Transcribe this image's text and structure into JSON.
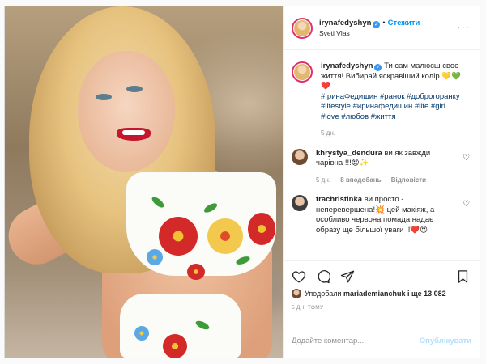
{
  "header": {
    "username": "irynafedyshyn",
    "follow_label": "Стежити",
    "location": "Sveti Vlas",
    "more_label": "···"
  },
  "caption": {
    "username": "irynafedyshyn",
    "text": "Ти сам малюєш своє життя! Вибирай яскравіший колір 💛💚❤️",
    "hashtags": "#ІринаФедишин #ранок #доброгоранку #lifestyle #иринафедишин #life #girl #love #любов #життя",
    "time": "5 дн."
  },
  "comments": [
    {
      "username": "khrystya_dendura",
      "text": "ви як завжди чарівна !!!😍✨",
      "time": "5 дн.",
      "likes": "8 вподобань",
      "reply": "Відповісти"
    },
    {
      "username": "trachristinka",
      "text": "ви просто - неперевершена!💥 цей макіяж, а особливо червона помада надає образу ще більшої уваги !!❤️😍",
      "time": "",
      "likes": "",
      "reply": ""
    }
  ],
  "likes": {
    "prefix": "Уподобали",
    "user": "mariademianchuk",
    "suffix": "і ще 13 082"
  },
  "time_ago": "5 ДН. ТОМУ",
  "add_comment": {
    "placeholder": "Додайте коментар...",
    "publish_label": "Опублікувати"
  },
  "colors": {
    "link": "#0095f6",
    "hashtag": "#00376b",
    "muted": "#8e8e8e",
    "publish_disabled": "#b2dffc",
    "lips": "#c4172d"
  },
  "icons": [
    "heart-icon",
    "comment-icon",
    "share-icon",
    "bookmark-icon",
    "more-icon",
    "verified-icon"
  ]
}
